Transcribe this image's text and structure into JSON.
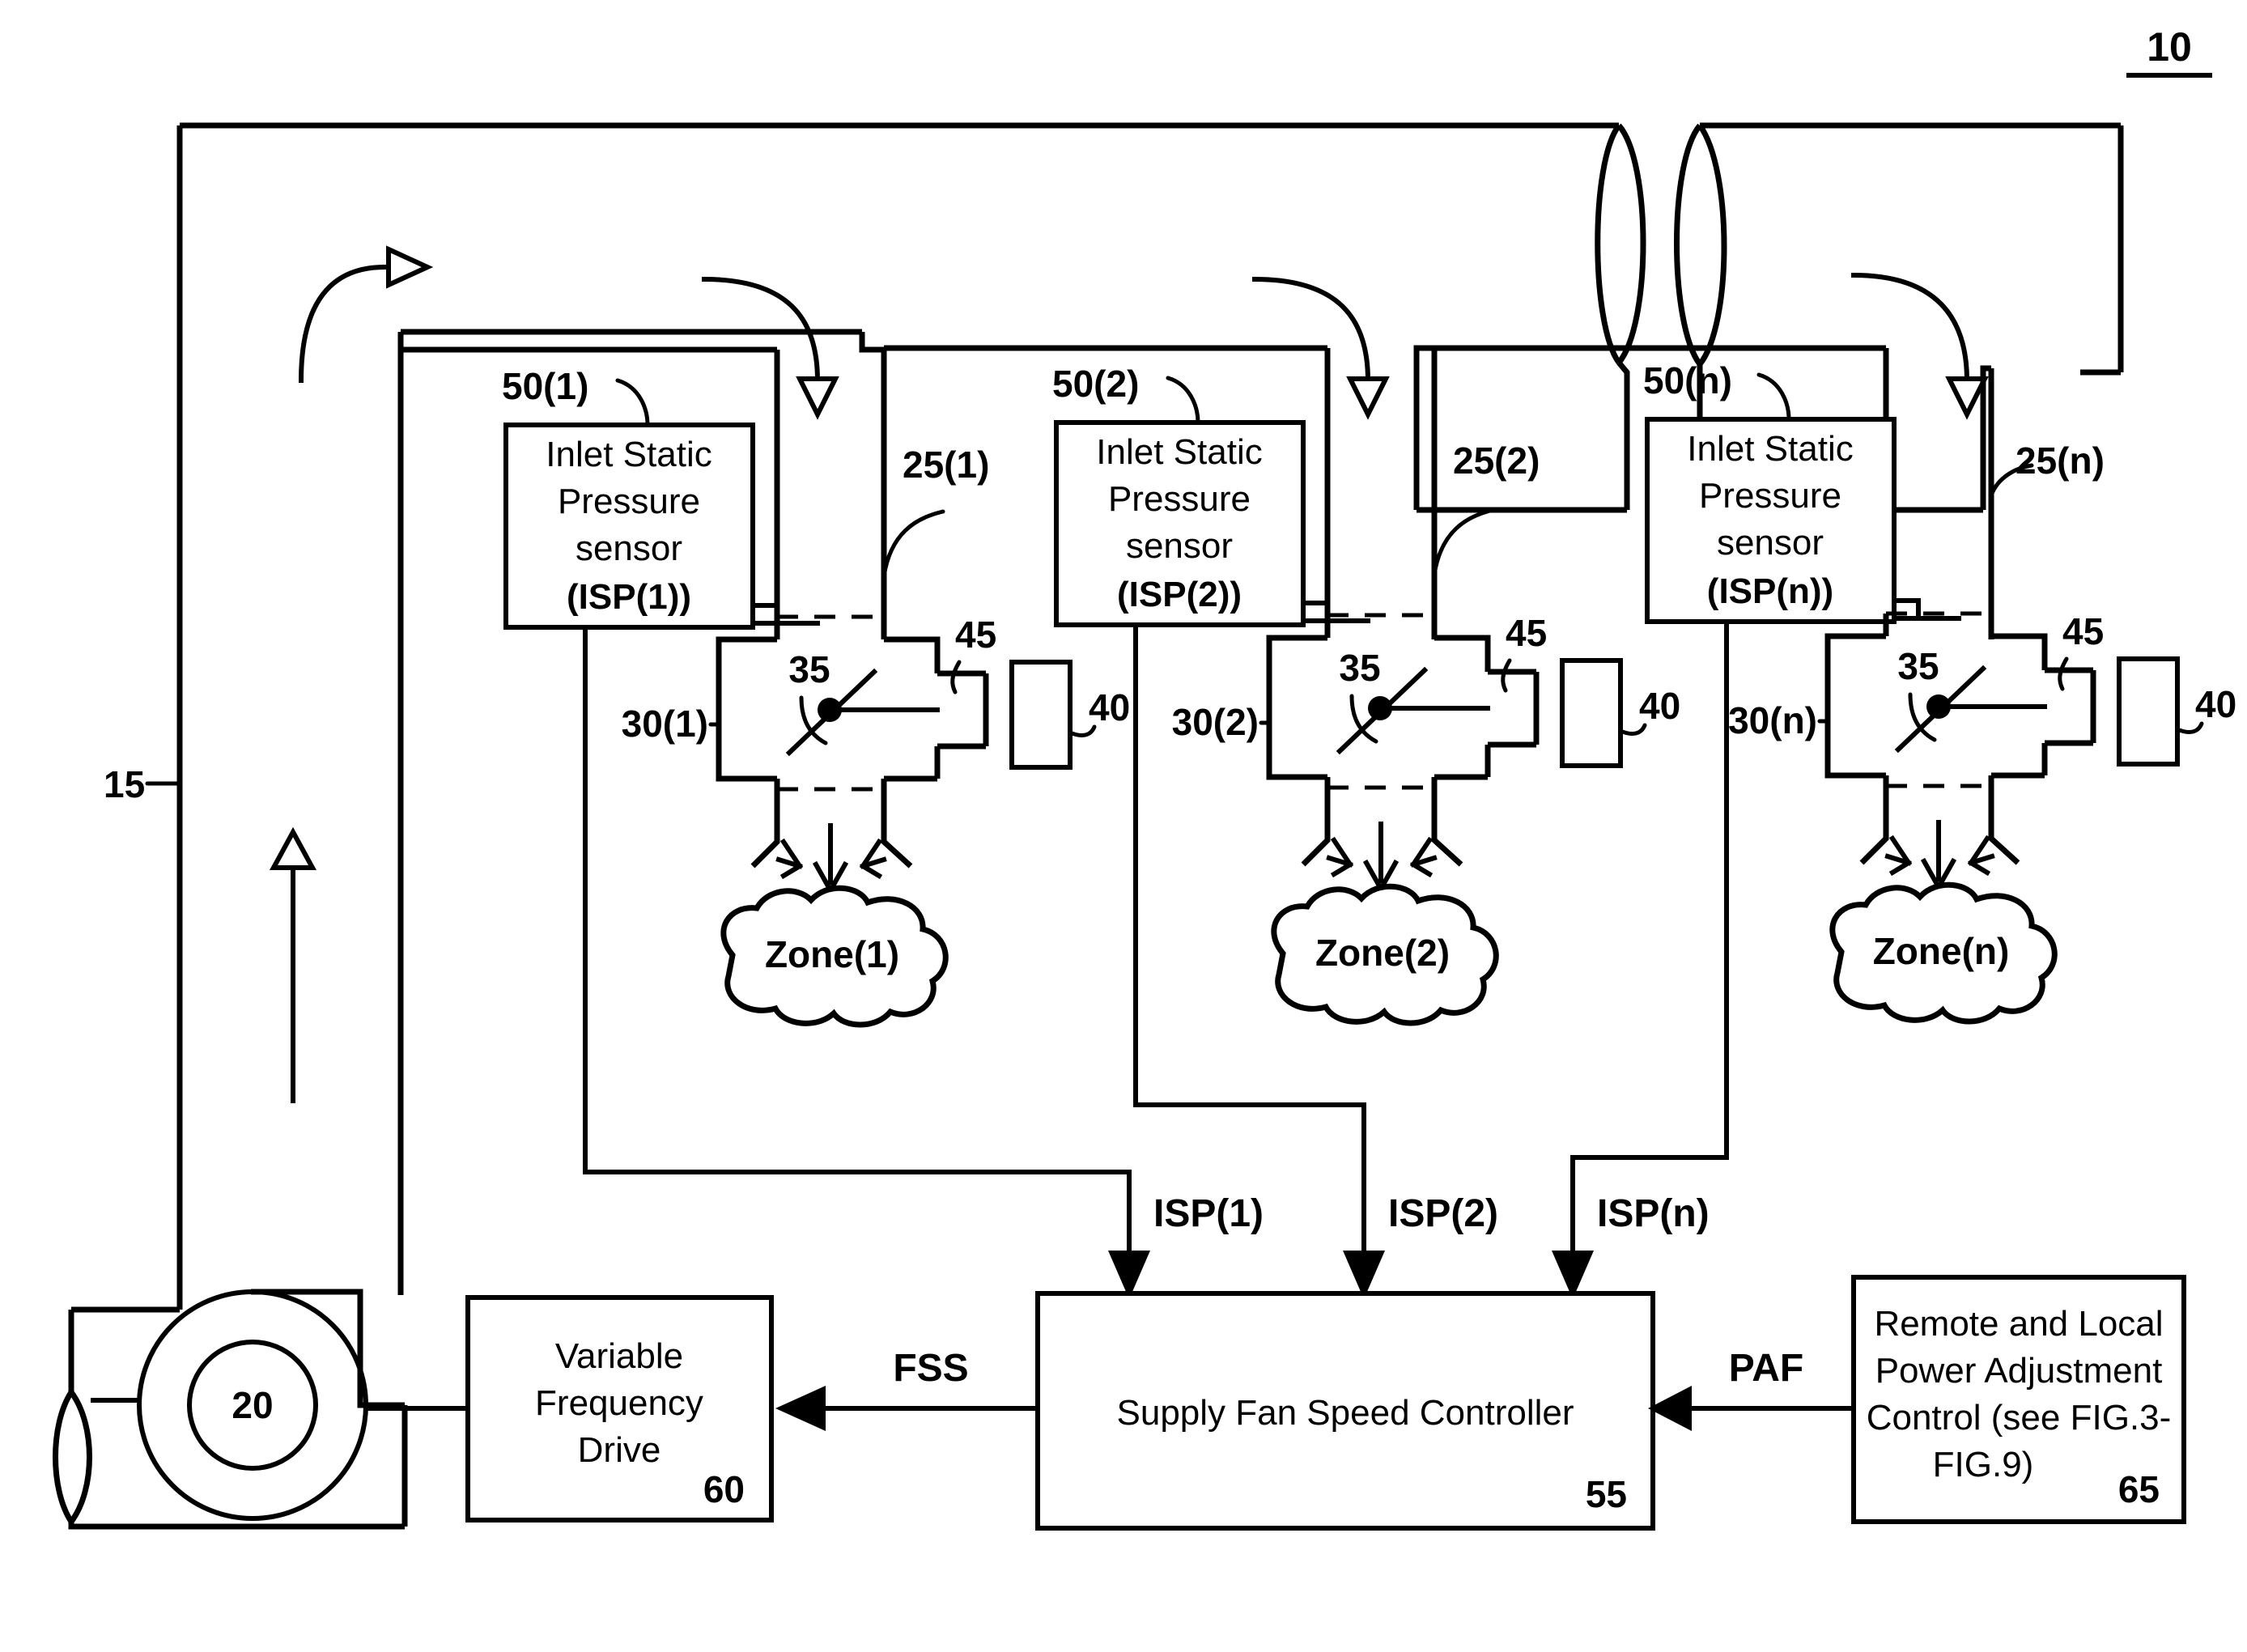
{
  "figure": {
    "number": "10"
  },
  "refs": {
    "duct_main": "15",
    "fan": "20",
    "branch_1": "25(1)",
    "branch_2": "25(2)",
    "branch_n": "25(n)",
    "vavbox_1": "30(1)",
    "vavbox_2": "30(2)",
    "vavbox_n": "30(n)",
    "damper": "35",
    "actuator": "40",
    "linkage": "45",
    "sensor_1": "50(1)",
    "sensor_2": "50(2)",
    "sensor_n": "50(n)",
    "controller": "55",
    "vfd": "60",
    "power_adjust": "65"
  },
  "sensors": [
    {
      "id": "sensor-1",
      "line1": "Inlet Static",
      "line2": "Pressure",
      "line3": "sensor",
      "line4": "(ISP(1))",
      "ref": "50(1)"
    },
    {
      "id": "sensor-2",
      "line1": "Inlet Static",
      "line2": "Pressure",
      "line3": "sensor",
      "line4": "(ISP(2))",
      "ref": "50(2)"
    },
    {
      "id": "sensor-n",
      "line1": "Inlet Static",
      "line2": "Pressure",
      "line3": "sensor",
      "line4": "(ISP(n))",
      "ref": "50(n)"
    }
  ],
  "zones": [
    {
      "label": "Zone(1)"
    },
    {
      "label": "Zone(2)"
    },
    {
      "label": "Zone(n)"
    }
  ],
  "signals": {
    "isp_1": "ISP(1)",
    "isp_2": "ISP(2)",
    "isp_n": "ISP(n)",
    "fss": "FSS",
    "paf": "PAF"
  },
  "blocks": {
    "vfd": {
      "line1": "Variable",
      "line2": "Frequency",
      "line3": "Drive",
      "ref": "60"
    },
    "controller": {
      "line1": "Supply Fan Speed Controller",
      "ref": "55"
    },
    "power_adjust": {
      "line1": "Remote and Local",
      "line2": "Power Adjustment",
      "line3": "Control (see FIG.3-",
      "line4": "FIG.9)",
      "ref": "65"
    }
  },
  "fan": {
    "label": "20"
  },
  "colors": {
    "ink": "#000000",
    "paper": "#ffffff"
  }
}
